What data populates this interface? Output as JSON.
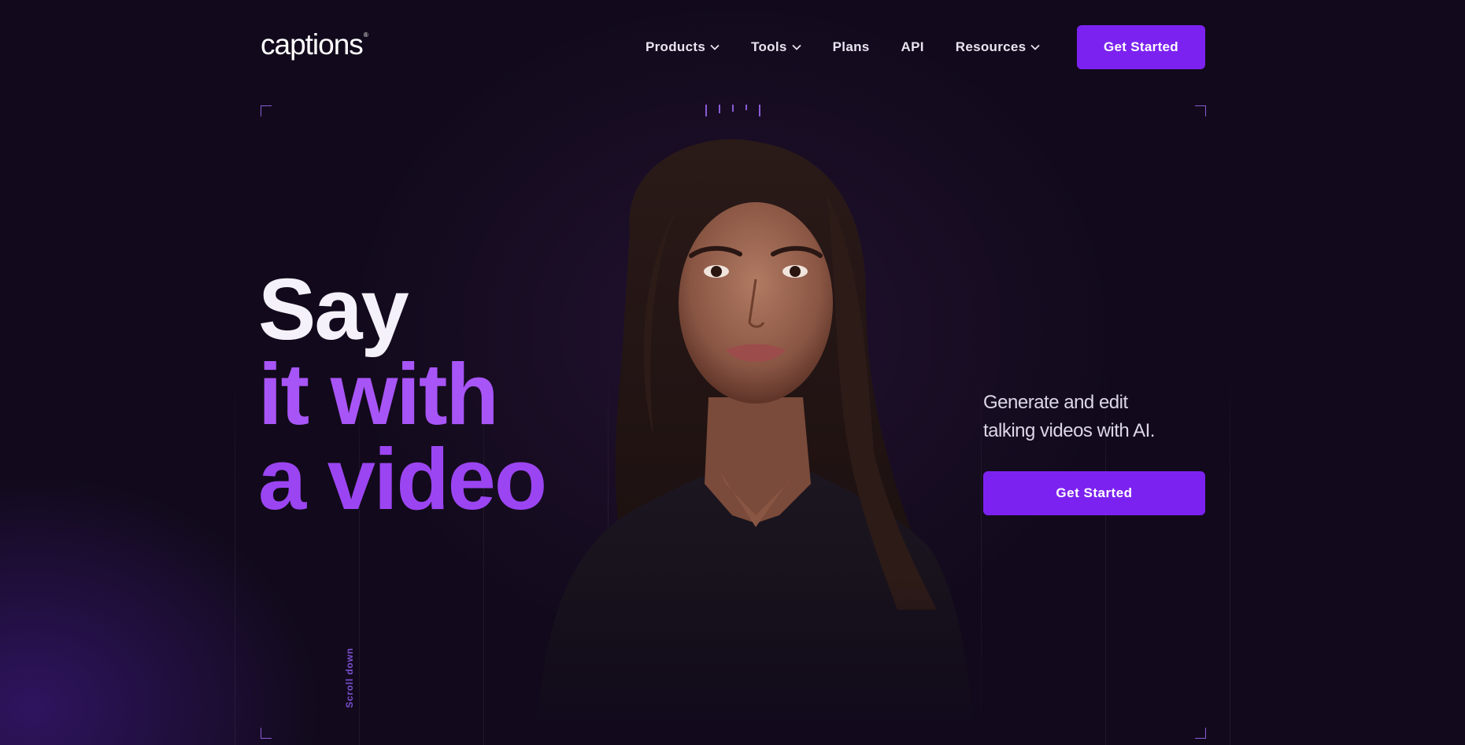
{
  "brand": {
    "logo_text": "captions",
    "logo_mark": "®"
  },
  "nav": {
    "items": [
      {
        "label": "Products",
        "has_dropdown": true
      },
      {
        "label": "Tools",
        "has_dropdown": true
      },
      {
        "label": "Plans",
        "has_dropdown": false
      },
      {
        "label": "API",
        "has_dropdown": false
      },
      {
        "label": "Resources",
        "has_dropdown": true
      }
    ],
    "cta_label": "Get Started"
  },
  "hero": {
    "headline_line1": "Say",
    "headline_line2": "it with",
    "headline_line3": "a video",
    "tagline_line1": "Generate and edit",
    "tagline_line2": "talking videos with AI.",
    "cta_label": "Get Started",
    "scroll_label": "Scroll down"
  },
  "colors": {
    "background": "#120a1c",
    "accent": "#7c22f0",
    "headline_accent": "#a855f7",
    "bracket": "#8a5bd6"
  },
  "icons": {
    "dropdown": "chevron-down-icon"
  }
}
